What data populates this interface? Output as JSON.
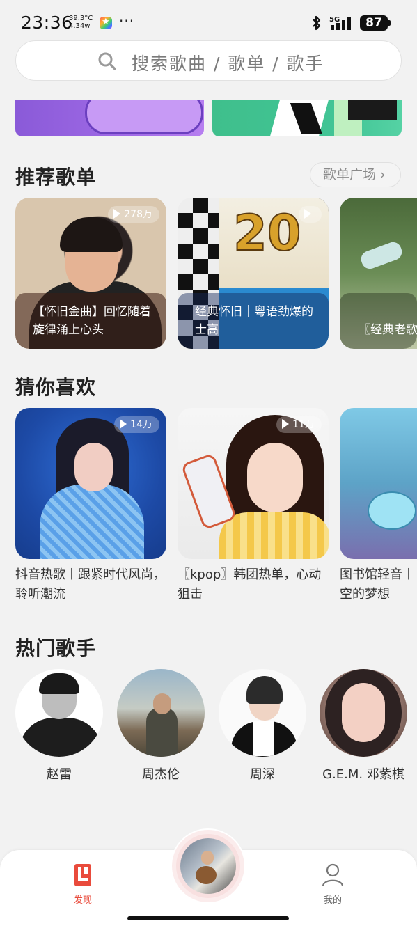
{
  "status_bar": {
    "time": "23:36",
    "temperature": "39.3°C",
    "power": "4.34w",
    "more": "···",
    "network": "5G",
    "battery": "87"
  },
  "search": {
    "placeholder": "搜索歌曲 / 歌单 / 歌手"
  },
  "recommended_playlists": {
    "title": "推荐歌单",
    "more_label": "歌单广场 ›",
    "items": [
      {
        "caption": "【怀旧金曲】回忆随着旋律涌上心头",
        "plays": "278万"
      },
      {
        "caption": "经典怀旧｜粤语劲爆的士高",
        "plays": ""
      },
      {
        "caption": "〖经典老歌〗时代，书写"
      }
    ]
  },
  "guess_you_like": {
    "title": "猜你喜欢",
    "items": [
      {
        "caption": "抖音热歌丨跟紧时代风尚，聆听潮流",
        "plays": "14万"
      },
      {
        "caption": "〖kpop〗韩团热单，心动狙击",
        "plays": "11万"
      },
      {
        "caption": "图书馆轻音丨空的梦想"
      }
    ]
  },
  "hot_singers": {
    "title": "热门歌手",
    "items": [
      {
        "name": "赵雷"
      },
      {
        "name": "周杰伦"
      },
      {
        "name": "周深"
      },
      {
        "name": "G.E.M. 邓紫棋"
      }
    ]
  },
  "bottom_nav": {
    "discover_label": "发现",
    "mine_label": "我的",
    "accent": "#e94b3c"
  }
}
